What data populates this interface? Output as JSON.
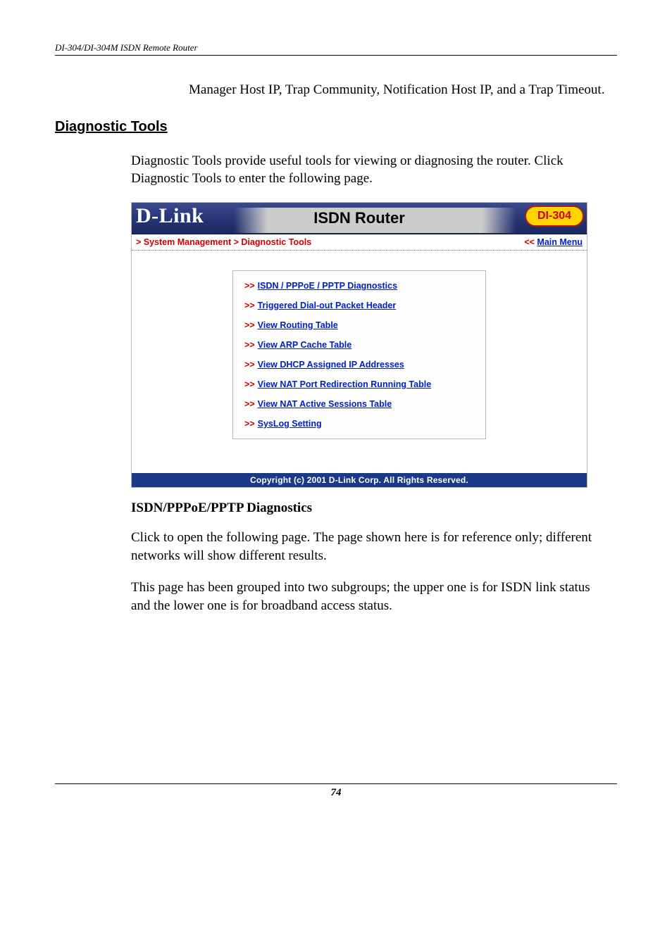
{
  "doc": {
    "running_header": "DI-304/DI-304M ISDN Remote Router",
    "intro_tail": "Manager Host IP, Trap Community, Notification Host IP, and a Trap Timeout.",
    "section_heading": "Diagnostic Tools",
    "para1": "Diagnostic Tools provide useful tools for viewing or diagnosing the router. Click Diagnostic Tools to enter the following page.",
    "subheading": "ISDN/PPPoE/PPTP Diagnostics",
    "para2": "Click to open the following page. The page shown here is for reference only; different networks will show different results.",
    "para3": "This page has been grouped into two subgroups; the upper one is for ISDN link status and the lower one is for broadband access status.",
    "page_number": "74"
  },
  "ss": {
    "logo": "D-Link",
    "title": "ISDN Router",
    "badge": "DI-304",
    "crumb": "> System Management > Diagnostic Tools",
    "main_menu_prefix": "<< ",
    "main_menu": "Main Menu",
    "menu": [
      "ISDN / PPPoE / PPTP Diagnostics",
      "Triggered Dial-out Packet Header",
      "View Routing Table",
      "View ARP Cache Table",
      "View DHCP Assigned IP Addresses",
      "View NAT Port Redirection Running Table",
      "View NAT Active Sessions Table",
      "SysLog Setting"
    ],
    "copyright": "Copyright (c) 2001 D-Link Corp. All Rights Reserved."
  }
}
